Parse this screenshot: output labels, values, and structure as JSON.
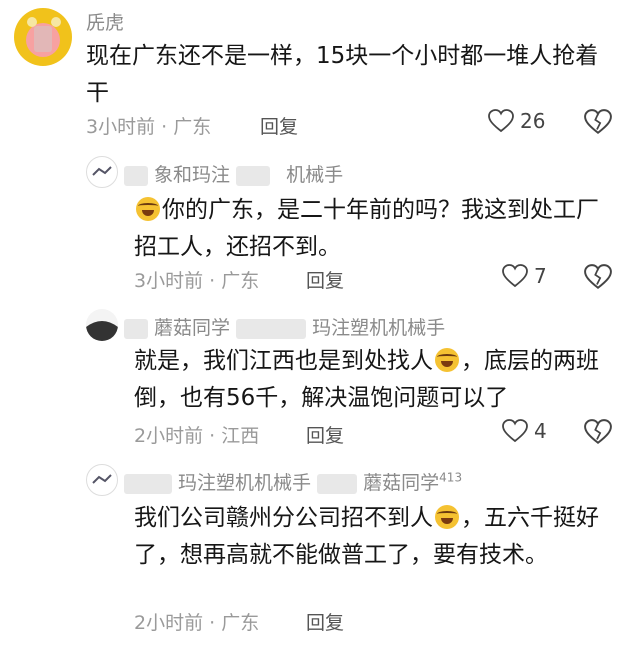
{
  "comments": [
    {
      "name": "兏虎",
      "text": "现在广东还不是一样，15块一个小时都一堆人抢着干",
      "meta": "3小时前 · 广东",
      "reply": "回复",
      "likes": "26"
    },
    {
      "name": "象和玛注",
      "name_suffix": "机械手",
      "text_pre": "",
      "text": "你的广东，是二十年前的吗？我这到处工厂招工人，还招不到。",
      "meta": "3小时前 · 广东",
      "reply": "回复",
      "likes": "7"
    },
    {
      "name": "蘑菇同学",
      "name_suffix": "玛注塑机机械手",
      "text_a": "就是，我们江西也是到处找人",
      "text_b": "，底层的两班倒，也有56千，解决温饱问题可以了",
      "meta": "2小时前 · 江西",
      "reply": "回复",
      "likes": "4"
    },
    {
      "name": "玛注塑机机械手",
      "name_suffix": "蘑菇同学",
      "name_sup": "413",
      "text_a": "我们公司赣州分公司招不到人",
      "text_b": "，五六千挺好了，想再高就不能做普工了，要有技术。",
      "meta": "2小时前 · 广东",
      "reply": "回复"
    }
  ],
  "icons": {
    "heart": "heart-icon",
    "dislike": "broken-heart-icon",
    "emoji": "laughing-emoji-icon"
  },
  "colors": {
    "meta": "#9a9a9a",
    "avatar_yellow": "#f1c21b"
  }
}
